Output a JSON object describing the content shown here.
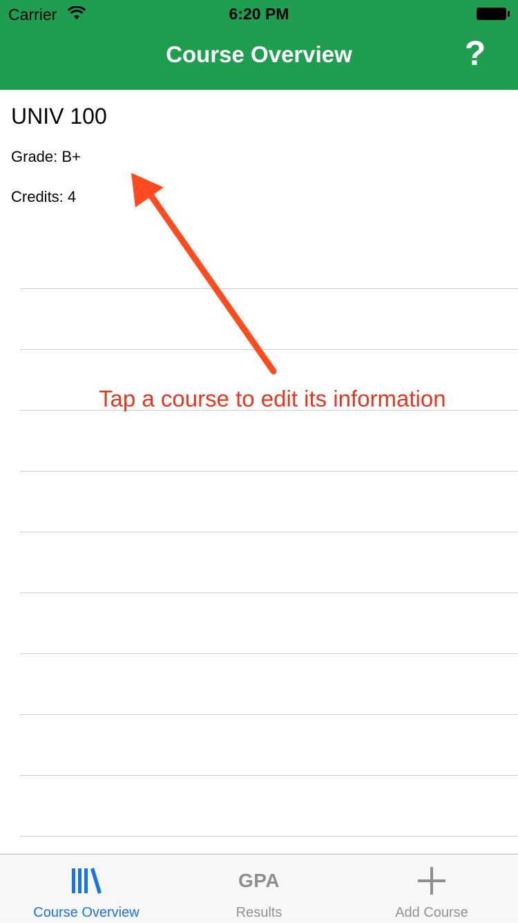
{
  "status_bar": {
    "carrier": "Carrier",
    "time": "6:20 PM"
  },
  "nav": {
    "title": "Course Overview",
    "help_label": "?"
  },
  "course": {
    "name": "UNIV 100",
    "grade": "Grade: B+",
    "credits": "Credits: 4"
  },
  "hint": {
    "text": "Tap a course to edit its information"
  },
  "tabs": [
    {
      "label": "Course Overview",
      "icon": "books-icon",
      "active": true
    },
    {
      "label": "Results",
      "icon_text": "GPA",
      "icon": "gpa-icon",
      "active": false
    },
    {
      "label": "Add Course",
      "icon": "plus-icon",
      "active": false
    }
  ],
  "colors": {
    "nav_green": "#1f9e4f",
    "active_blue": "#1a73e8",
    "inactive_gray": "#929292",
    "hint_red": "#e8351f",
    "arrow_orange": "#ff4b1e"
  }
}
